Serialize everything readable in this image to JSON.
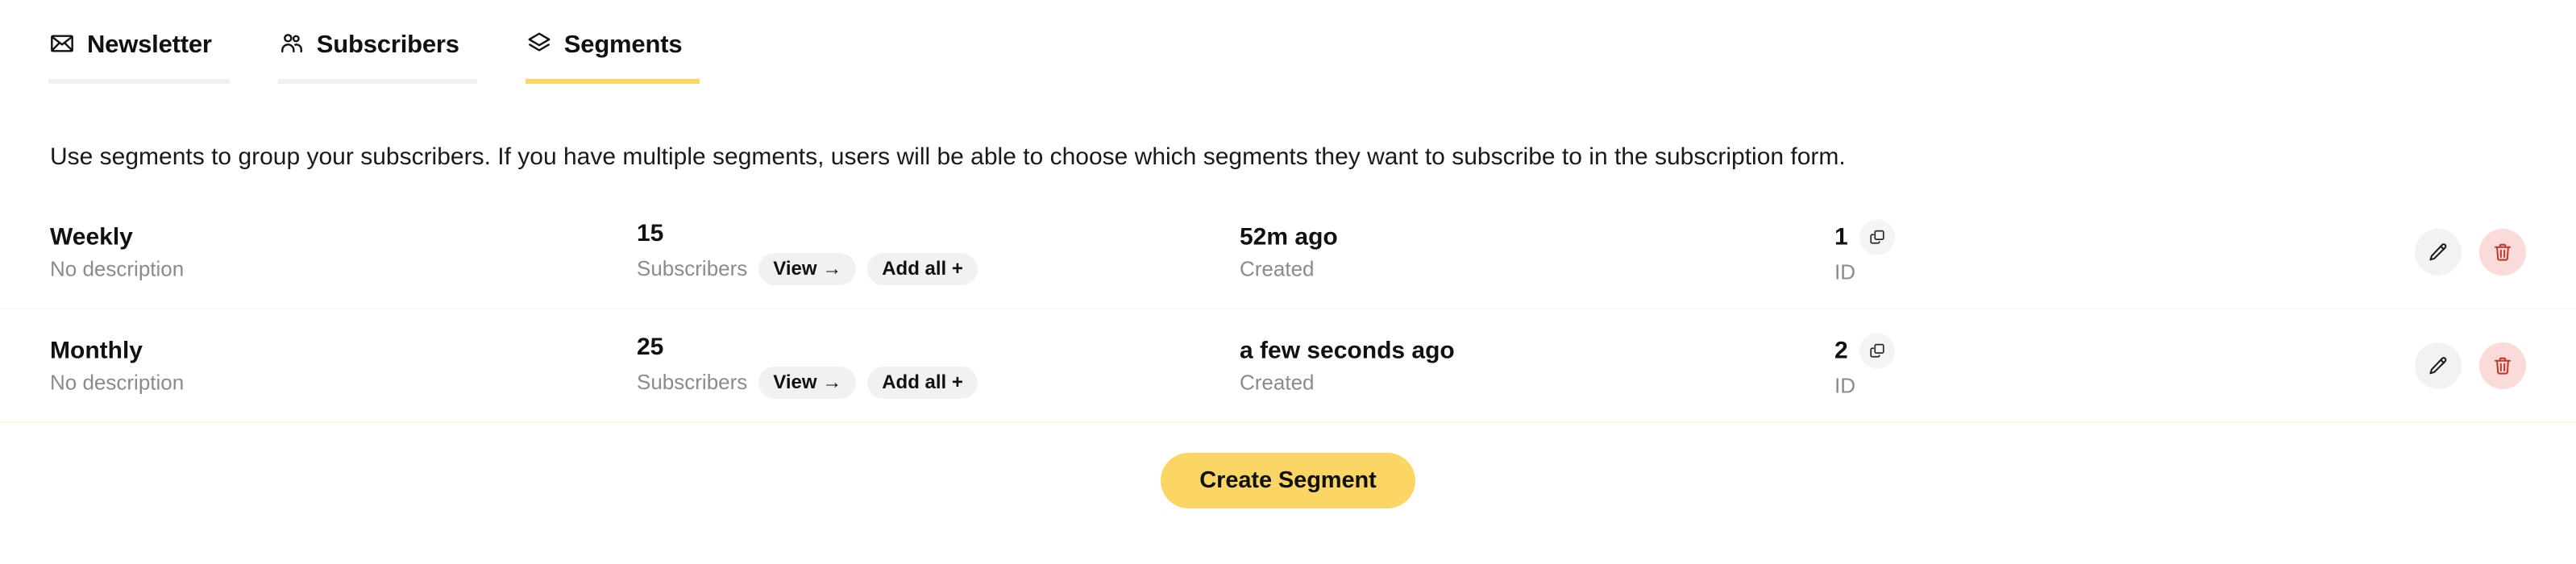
{
  "tabs": [
    {
      "id": "newsletter",
      "label": "Newsletter",
      "icon": "envelope-icon",
      "active": false
    },
    {
      "id": "subscribers",
      "label": "Subscribers",
      "icon": "users-icon",
      "active": false
    },
    {
      "id": "segments",
      "label": "Segments",
      "icon": "layers-icon",
      "active": true
    }
  ],
  "intro": {
    "text": "Use segments to group your subscribers. If you have multiple segments, users will be able to choose which segments they want to subscribe to in the subscription form."
  },
  "labels": {
    "subscribers": "Subscribers",
    "created": "Created",
    "id": "ID",
    "view": "View →",
    "add_all": "Add all +"
  },
  "rows": [
    {
      "name": "Weekly",
      "description": "No description",
      "subscriber_count": "15",
      "created": "52m ago",
      "id": "1"
    },
    {
      "name": "Monthly",
      "description": "No description",
      "subscriber_count": "25",
      "created": "a few seconds ago",
      "id": "2"
    }
  ],
  "footer": {
    "create_label": "Create Segment"
  },
  "colors": {
    "accent": "#fbd664",
    "tab_rail": "#f0f0f0",
    "row_divider": "#fbf7e7",
    "pill_bg": "#f1f1f1",
    "delete_bg": "#fbdada",
    "delete_fg": "#c0392b",
    "muted_text": "#8b8b8b"
  }
}
